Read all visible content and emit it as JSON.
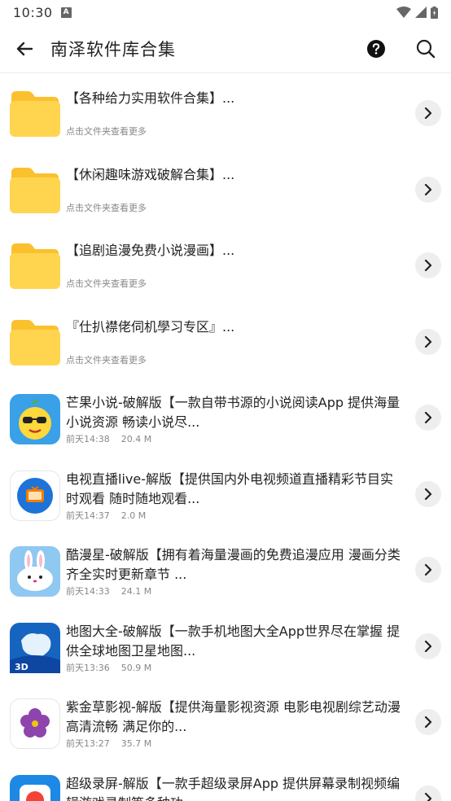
{
  "status": {
    "time": "10:30",
    "notification_glyph": "A"
  },
  "app_bar": {
    "title": "南泽软件库合集"
  },
  "folders": [
    {
      "title": "【各种给力实用软件合集】...",
      "subtitle": "点击文件夹查看更多"
    },
    {
      "title": "【休闲趣味游戏破解合集】...",
      "subtitle": "点击文件夹查看更多"
    },
    {
      "title": "【追剧追漫免费小说漫画】...",
      "subtitle": "点击文件夹查看更多"
    },
    {
      "title": "『仕扒襟佬伺机學习专区』...",
      "subtitle": "点击文件夹查看更多"
    }
  ],
  "files": [
    {
      "title": "芒果小说-破解版【一款自带书源的小说阅读App 提供海量小说资源 畅读小说尽...",
      "time": "前天14:38",
      "size": "20.4 M",
      "icon": "mango-novel-icon"
    },
    {
      "title": "电视直播live-解版【提供国内外电视频道直播精彩节目实时观看 随时随地观看...",
      "time": "前天14:37",
      "size": "2.0 M",
      "icon": "tv-live-icon"
    },
    {
      "title": "酷漫星-破解版【拥有着海量漫画的免费追漫应用 漫画分类齐全实时更新章节 ...",
      "time": "前天14:33",
      "size": "24.1 M",
      "icon": "comic-star-icon"
    },
    {
      "title": "地图大全-破解版【一款手机地图大全App世界尽在掌握 提供全球地图卫星地图...",
      "time": "前天13:36",
      "size": "50.9 M",
      "icon": "map-3d-icon"
    },
    {
      "title": "紫金草影视-解版【提供海量影视资源 电影电视剧综艺动漫 高清流畅 满足你的...",
      "time": "前天13:27",
      "size": "35.7 M",
      "icon": "purple-flower-icon"
    },
    {
      "title": "超级录屏-解版【一款手超级录屏App 提供屏幕录制视频编辑游戏录制等多种功",
      "time": "",
      "size": "",
      "icon": "screen-record-icon"
    }
  ],
  "colors": {
    "folder": "#FFD54F",
    "folder_tab": "#FBC02D",
    "chevron_bg": "#EEEEEE",
    "subtitle": "#888888"
  },
  "icons": {
    "back": "arrow-left-icon",
    "help": "question-circle-icon",
    "search": "search-icon",
    "chevron": "chevron-right-icon"
  }
}
